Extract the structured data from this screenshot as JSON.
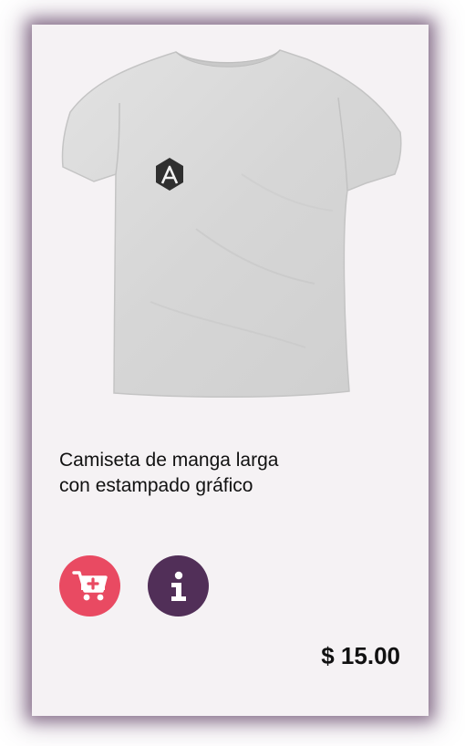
{
  "product": {
    "name": "Camiseta de manga larga con estampado gráfico",
    "price": "$ 15.00",
    "image_alt": "Camiseta gris con logotipo"
  },
  "actions": {
    "add_to_cart": {
      "icon": "cart-plus-icon",
      "color": "#e94a62"
    },
    "info": {
      "icon": "info-icon",
      "label": "i",
      "color": "#512f58"
    }
  },
  "colors": {
    "card_background": "#f5f2f4",
    "shadow": "#46234b",
    "shirt": "#d9d9d9"
  }
}
